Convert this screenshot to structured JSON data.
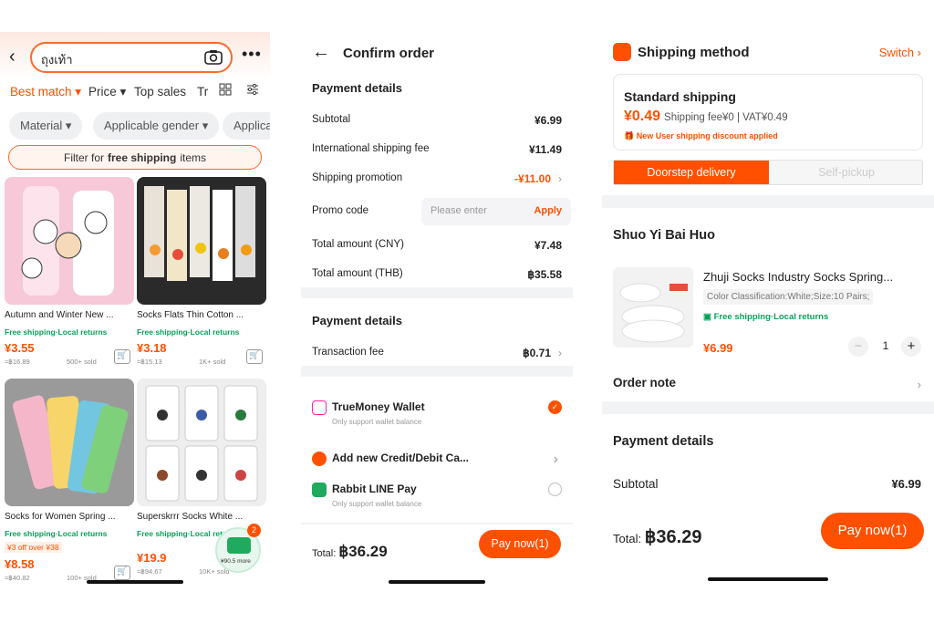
{
  "colors": {
    "accent": "#ff5000",
    "green": "#0aa05a"
  },
  "p1": {
    "search_query": "ถุงเท้า",
    "sort": {
      "best_match": "Best match",
      "price": "Price",
      "top_sales": "Top sales",
      "trunc": "Tr"
    },
    "chips": [
      "Material",
      "Applicable gender",
      "Applica"
    ],
    "free_filter": {
      "pre": "Filter for",
      "bold": "free shipping",
      "post": "items"
    },
    "products": [
      {
        "title": "Autumn and Winter New ...",
        "badge": "Free shipping·Local returns",
        "price": "¥3.55",
        "ref": "≈฿16.89",
        "sold": "500+ sold"
      },
      {
        "title": "Socks Flats Thin Cotton ...",
        "badge": "Free shipping·Local returns",
        "price": "¥3.18",
        "ref": "≈฿15.13",
        "sold": "1K+ sold"
      },
      {
        "title": "Socks for Women Spring ...",
        "badge": "Free shipping·Local returns",
        "off": "¥3 off over ¥38",
        "price": "¥8.58",
        "ref": "≈฿40.82",
        "sold": "100+ sold"
      },
      {
        "title": "Superskrrr Socks White ...",
        "badge": "Free shipping·Local returns",
        "price": "¥19.9",
        "ref": "≈฿94.67",
        "sold": "10K+ sold"
      }
    ],
    "float": {
      "badge": "2",
      "more": "¥90.5 more"
    }
  },
  "p2": {
    "title": "Confirm order",
    "section1": "Payment details",
    "rows": [
      {
        "label": "Subtotal",
        "value": "¥6.99"
      },
      {
        "label": "International shipping fee",
        "value": "¥11.49"
      },
      {
        "label": "Shipping promotion",
        "value": "-¥11.00"
      },
      {
        "label": "Promo code",
        "placeholder": "Please enter",
        "apply": "Apply"
      },
      {
        "label": "Total amount (CNY)",
        "value": "¥7.48"
      },
      {
        "label": "Total amount (THB)",
        "value": "฿35.58"
      }
    ],
    "section2": "Payment details",
    "fee": {
      "label": "Transaction fee",
      "value": "฿0.71"
    },
    "methods": [
      {
        "name": "TrueMoney Wallet",
        "note": "Only support wallet balance",
        "selected": true
      },
      {
        "name": "Add new Credit/Debit Ca...",
        "note": ""
      },
      {
        "name": "Rabbit LINE Pay",
        "note": "Only support wallet balance",
        "selected": false
      }
    ],
    "total_label": "Total:",
    "total_value": "฿36.29",
    "pay_button": "Pay now(1)"
  },
  "p3": {
    "shipping_title": "Shipping method",
    "switch": "Switch",
    "standard": "Standard shipping",
    "fee_price": "¥0.49",
    "fee_detail": "Shipping fee¥0 | VAT¥0.49",
    "discount": "New User shipping discount applied",
    "tab_doorstep": "Doorstep delivery",
    "tab_pickup": "Self-pickup",
    "store": "Shuo Yi Bai Huo",
    "product_name": "Zhuji Socks Industry Socks Spring...",
    "variant": "Color Classification:White;Size:10 Pairs;",
    "free_ship": "Free shipping·Local returns",
    "price": "¥6.99",
    "qty": "1",
    "order_note": "Order note",
    "payment_details": "Payment details",
    "subtotal_label": "Subtotal",
    "subtotal_value": "¥6.99",
    "total_label": "Total:",
    "total_value": "฿36.29",
    "pay_button": "Pay now(1)"
  }
}
